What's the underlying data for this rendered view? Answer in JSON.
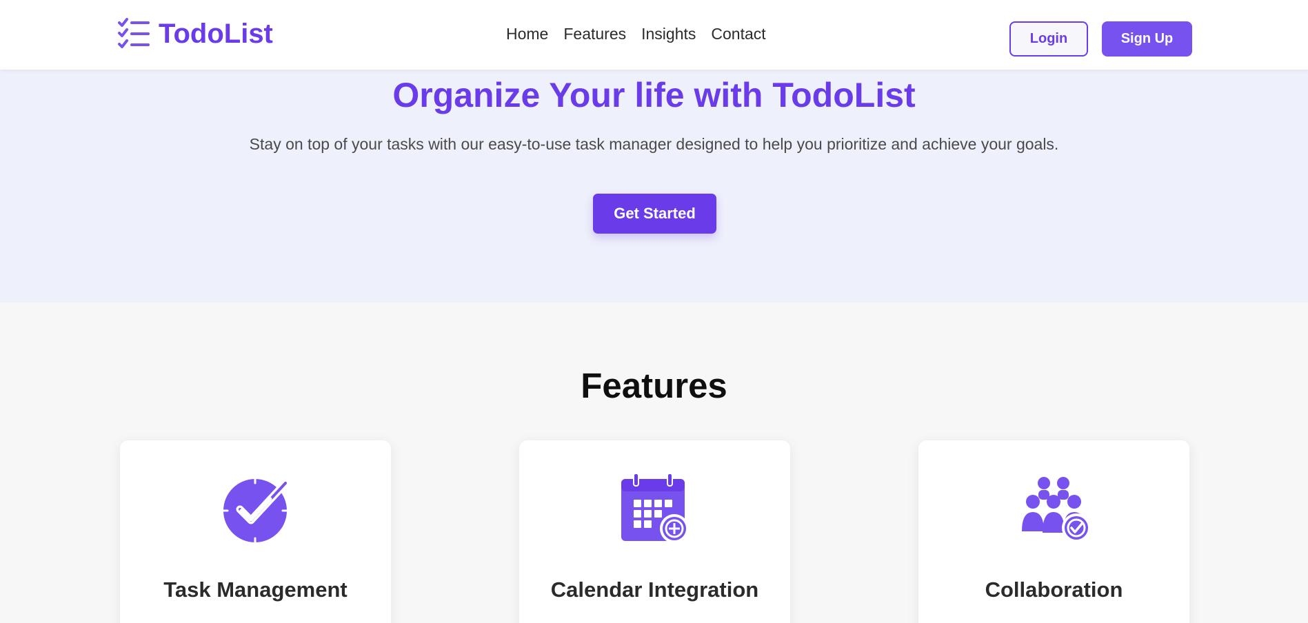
{
  "colors": {
    "brand": "#6a3ce9",
    "brand_light": "#7752ef",
    "hero_bg": "#eef0fb",
    "page_bg": "#f7f7f7"
  },
  "header": {
    "logo_icon": "checklist-icon",
    "logo_text": "TodoList",
    "nav": [
      {
        "label": "Home"
      },
      {
        "label": "Features"
      },
      {
        "label": "Insights"
      },
      {
        "label": "Contact"
      }
    ],
    "login_label": "Login",
    "signup_label": "Sign Up"
  },
  "hero": {
    "title": "Organize Your life with TodoList",
    "subtitle": "Stay on top of your tasks with our easy-to-use task manager designed to help you prioritize and achieve your goals.",
    "cta_label": "Get Started"
  },
  "features": {
    "heading": "Features",
    "cards": [
      {
        "icon": "clock-check-icon",
        "title": "Task Management"
      },
      {
        "icon": "calendar-plus-icon",
        "title": "Calendar Integration"
      },
      {
        "icon": "team-check-icon",
        "title": "Collaboration"
      }
    ]
  }
}
